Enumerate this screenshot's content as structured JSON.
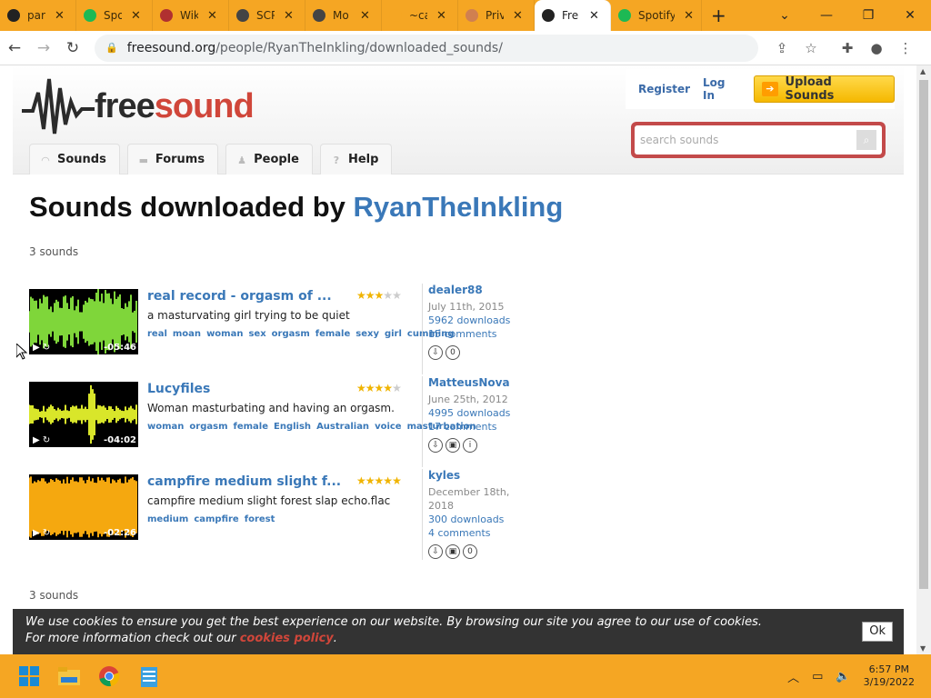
{
  "browser": {
    "tabs": [
      {
        "title": "par",
        "color": "#222"
      },
      {
        "title": "Spo",
        "color": "#1db954"
      },
      {
        "title": "Wik",
        "color": "#b03030"
      },
      {
        "title": "SCP",
        "color": "#444"
      },
      {
        "title": "Mo",
        "color": "#444"
      },
      {
        "title": "~ca",
        "color": "#f5a623"
      },
      {
        "title": "Priv",
        "color": "#d08050"
      },
      {
        "title": "Fre",
        "color": "#222",
        "active": true
      },
      {
        "title": "Spotify",
        "color": "#1db954"
      }
    ],
    "url_host": "freesound.org",
    "url_path": "/people/RyanTheInkling/downloaded_sounds/"
  },
  "header": {
    "logo_word_dark": "free",
    "logo_word_red": "sound",
    "register": "Register",
    "login": "Log In",
    "upload": "Upload Sounds",
    "search_placeholder": "search sounds",
    "nav": [
      {
        "label": "Sounds",
        "icon": "headphones-icon"
      },
      {
        "label": "Forums",
        "icon": "chat-icon"
      },
      {
        "label": "People",
        "icon": "people-icon"
      },
      {
        "label": "Help",
        "icon": "help-icon"
      }
    ]
  },
  "main": {
    "title_prefix": "Sounds downloaded by ",
    "username": "RyanTheInkling",
    "count_top": "3 sounds",
    "count_bottom": "3 sounds",
    "sounds": [
      {
        "name": "real record - orgasm of ...",
        "description": "a masturvating girl trying to be quiet",
        "tags": [
          "real",
          "moan",
          "woman",
          "sex",
          "orgasm",
          "female",
          "sexy",
          "girl",
          "cumming"
        ],
        "duration": "-05:46",
        "stars": 3,
        "wave_color": "#7fd63a",
        "author": "dealer88",
        "date": "July 11th, 2015",
        "downloads": "5962 downloads",
        "comments": "15 comments"
      },
      {
        "name": "Lucyfiles",
        "description": "Woman masturbating and having an orgasm.",
        "tags": [
          "woman",
          "orgasm",
          "female",
          "English",
          "Australian",
          "voice",
          "masturbation"
        ],
        "duration": "-04:02",
        "stars": 3.5,
        "wave_color": "#d9e62a",
        "author": "MatteusNova",
        "date": "June 25th, 2012",
        "downloads": "4995 downloads",
        "comments": "17 comments"
      },
      {
        "name": "campfire medium slight f...",
        "description": "campfire medium slight forest slap echo.flac",
        "tags": [
          "medium",
          "campfire",
          "forest"
        ],
        "duration": "-02:26",
        "stars": 5,
        "wave_color": "#f5a80f",
        "author": "kyles",
        "date": "December 18th, 2018",
        "downloads": "300 downloads",
        "comments": "4 comments"
      }
    ]
  },
  "cookie": {
    "line1": "We use cookies to ensure you get the best experience on our website. By browsing our site you agree to our use of cookies.",
    "line2_prefix": "For more information check out our ",
    "link": "cookies policy",
    "line2_suffix": ".",
    "ok": "Ok"
  },
  "taskbar": {
    "time": "6:57 PM",
    "date": "3/19/2022"
  }
}
